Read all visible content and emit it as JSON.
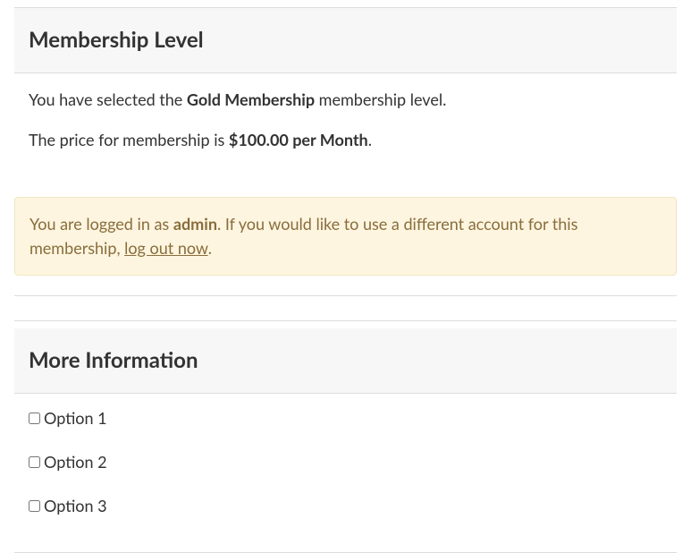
{
  "membership": {
    "heading": "Membership Level",
    "selected_prefix": "You have selected the ",
    "level_name": "Gold Membership",
    "selected_suffix": " membership level.",
    "price_prefix": "The price for membership is ",
    "price": "$100.00 per Month",
    "price_suffix": "."
  },
  "alert": {
    "prefix": "You are logged in as ",
    "username": "admin",
    "middle": ". If you would like to use a different account for this membership, ",
    "link_text": "log out now",
    "suffix": "."
  },
  "more_info": {
    "heading": "More Information",
    "options": [
      "Option 1",
      "Option 2",
      "Option 3"
    ]
  }
}
